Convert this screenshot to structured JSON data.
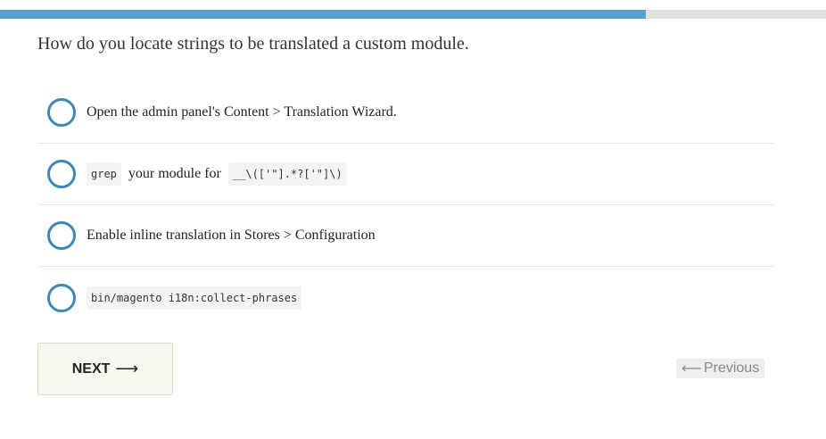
{
  "progress": {
    "fraction": 0.782,
    "fill_color": "#5ba0c8",
    "track_color": "#e2e2e2"
  },
  "question": "How do you locate strings to be translated a custom module.",
  "options": [
    {
      "text": "Open the admin panel's Content > Translation Wizard."
    },
    {
      "code1": "grep",
      "text": "your module for",
      "code2": "__\\(['\"].*?['\"]\\)"
    },
    {
      "text": "Enable inline translation in Stores > Configuration"
    },
    {
      "code1": "bin/magento i18n:collect-phrases"
    }
  ],
  "buttons": {
    "next_label": "NEXT",
    "next_arrow": "⟶",
    "prev_arrow": "⟵",
    "prev_label": "Previous"
  },
  "icons": {
    "radio": "radio-unselected-icon",
    "next": "arrow-right-icon",
    "prev": "arrow-left-icon"
  }
}
